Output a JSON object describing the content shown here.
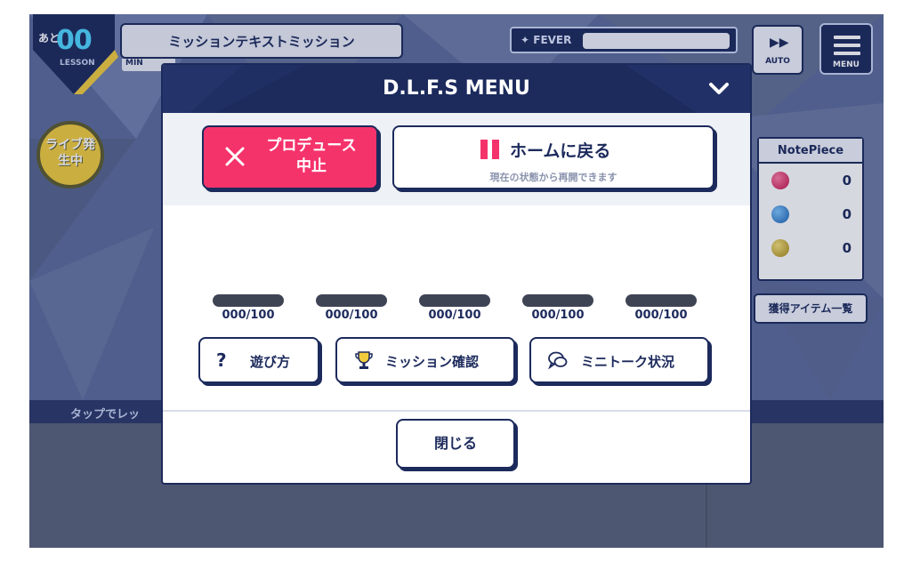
{
  "hud": {
    "lesson_prefix": "あと",
    "lesson_count": "00",
    "lesson_label": "LESSON",
    "mission_text": "ミッションテキストミッション",
    "mini_tag": "MIN",
    "fever_label": "FEVER",
    "auto_label": "AUTO",
    "menu_label": "MENU",
    "live_badge": "ライブ発生中",
    "tap_hint": "タップでレッ",
    "items_button": "獲得アイテム一覧"
  },
  "note_piece": {
    "title": "NotePiece",
    "rows": [
      {
        "color": "#e2245f",
        "value": "0"
      },
      {
        "color": "#2a86d9",
        "value": "0"
      },
      {
        "color": "#d2b12e",
        "value": "0"
      }
    ]
  },
  "modal": {
    "title": "D.L.F.S MENU",
    "stop_button": "プロデュース\n中止",
    "home_button": "ホームに戻る",
    "home_subtext": "現在の状態から再開できます",
    "progress": [
      {
        "label": "000/100",
        "value": 0
      },
      {
        "label": "000/100",
        "value": 0
      },
      {
        "label": "000/100",
        "value": 0
      },
      {
        "label": "000/100",
        "value": 0
      },
      {
        "label": "000/100",
        "value": 0
      }
    ],
    "how_to_play": "遊び方",
    "mission_check": "ミッション確認",
    "mini_talk": "ミニトーク状況",
    "close_button": "閉じる"
  },
  "colors": {
    "navy": "#1c2a5c",
    "accent_pink": "#f5336b",
    "cyan": "#4fd6ff"
  }
}
